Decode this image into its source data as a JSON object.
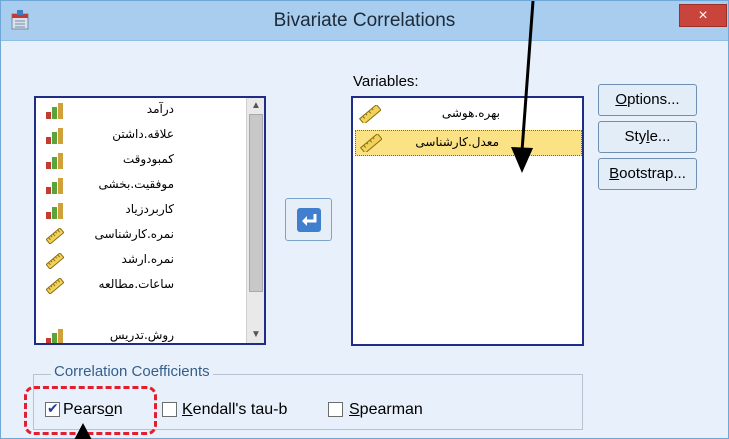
{
  "window": {
    "title": "Bivariate Correlations",
    "close_glyph": "×",
    "icon": "spss-app-icon"
  },
  "source_list": {
    "items": [
      {
        "label": "درآمد",
        "icon": "bar-chart-icon"
      },
      {
        "label": "علاقه.داشتن",
        "icon": "bar-chart-icon"
      },
      {
        "label": "کمبودوقت",
        "icon": "bar-chart-icon"
      },
      {
        "label": "موفقیت.بخشی",
        "icon": "bar-chart-icon"
      },
      {
        "label": "کاربردزیاد",
        "icon": "bar-chart-icon"
      },
      {
        "label": "نمره.کارشناسی",
        "icon": "ruler-icon"
      },
      {
        "label": "نمره.ارشد",
        "icon": "ruler-icon"
      },
      {
        "label": "ساعات.مطالعه",
        "icon": "ruler-icon"
      },
      {
        "label": "روش.تدریس",
        "icon": "bar-chart-icon"
      }
    ]
  },
  "variables": {
    "label": "Variables:",
    "items": [
      {
        "label": "بهره.هوشی",
        "icon": "ruler-icon",
        "selected": false
      },
      {
        "label": "معدل.کارشناسی",
        "icon": "ruler-icon",
        "selected": true
      }
    ]
  },
  "buttons": {
    "options": "Options...",
    "style": "Style...",
    "bootstrap": "Bootstrap..."
  },
  "coefficients": {
    "title": "Correlation Coefficients",
    "pearson": {
      "label": "Pearson",
      "checked": true
    },
    "kendall": {
      "label": "Kendall's tau-b",
      "checked": false
    },
    "spearman": {
      "label": "Spearman",
      "checked": false
    }
  },
  "colors": {
    "highlight": "#fbe285",
    "annotation_dash": "#e0202f",
    "list_border": "#1f2d86",
    "close": "#c9453b"
  }
}
